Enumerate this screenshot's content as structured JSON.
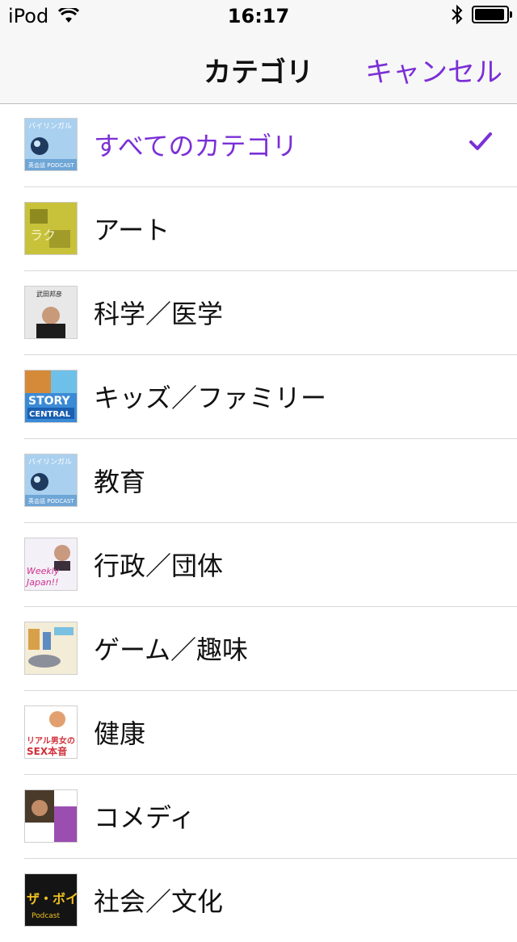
{
  "status": {
    "device": "iPod",
    "time": "16:17"
  },
  "nav": {
    "title": "カテゴリ",
    "cancel_label": "キャンセル"
  },
  "categories": [
    {
      "label": "すべてのカテゴリ",
      "selected": true,
      "thumb": "bilingual-news"
    },
    {
      "label": "アート",
      "selected": false,
      "thumb": "art-podcast"
    },
    {
      "label": "科学／医学",
      "selected": false,
      "thumb": "takeda-podcast"
    },
    {
      "label": "キッズ／ファミリー",
      "selected": false,
      "thumb": "story-central"
    },
    {
      "label": "教育",
      "selected": false,
      "thumb": "bilingual-news"
    },
    {
      "label": "行政／団体",
      "selected": false,
      "thumb": "weekly-japan"
    },
    {
      "label": "ゲーム／趣味",
      "selected": false,
      "thumb": "hobby-podcast"
    },
    {
      "label": "健康",
      "selected": false,
      "thumb": "real-sex-podcast"
    },
    {
      "label": "コメディ",
      "selected": false,
      "thumb": "comedy-podcast"
    },
    {
      "label": "社会／文化",
      "selected": false,
      "thumb": "za-voice"
    }
  ],
  "colors": {
    "accent": "#7b2fd6",
    "bar_bg": "#f7f7f7"
  }
}
